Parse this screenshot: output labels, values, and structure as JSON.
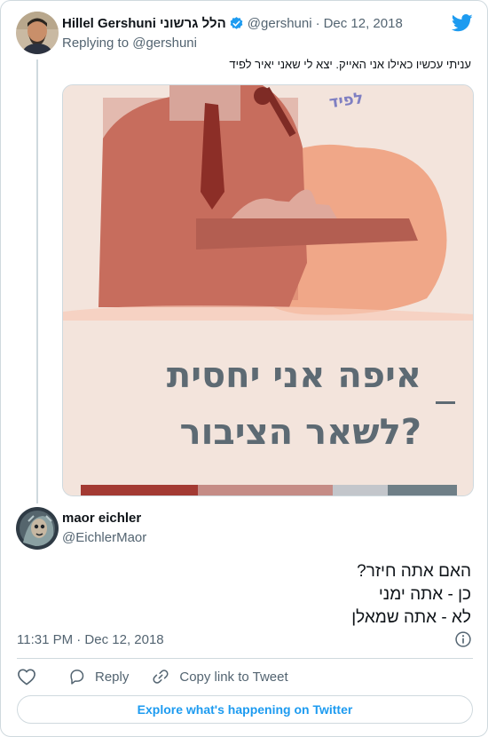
{
  "parent_tweet": {
    "display_name": "Hillel Gershuni הלל גרשוני",
    "handle": "@gershuni",
    "separator": "·",
    "date": "Dec 12, 2018",
    "replying_prefix": "Replying to",
    "replying_to": "@gershuni",
    "text": "עניתי עכשיו כאילו אני האייק. יצא לי שאני יאיר לפיד",
    "verified": true,
    "avatar_icon": "user-avatar-photo",
    "media": {
      "image_icon": "poster-photo",
      "corner_text": "לפיד",
      "headline_line1": "איפה אני יחסית",
      "headline_line2": "לשאר הציבור?",
      "colors": {
        "background": "#f3e4dc",
        "photo_tint": "#c76d5d",
        "blob": "#f0a788",
        "headline": "#5d6a73"
      },
      "strip_colors": [
        "#a33a33",
        "#c58c86",
        "#c3c6cb",
        "#6f7f87"
      ]
    }
  },
  "main_tweet": {
    "display_name": "maor eichler",
    "handle": "@EichlerMaor",
    "text_lines": [
      "האם אתה חיזר?",
      "כן - אתה ימני",
      "לא - אתה שמאלן"
    ],
    "timestamp": "11:31 PM · Dec 12, 2018",
    "avatar_icon": "user-avatar-photo"
  },
  "actions": {
    "like_icon": "heart-icon",
    "reply_icon": "reply-icon",
    "reply_label": "Reply",
    "copy_icon": "link-icon",
    "copy_label": "Copy link to Tweet",
    "info_icon": "info-icon"
  },
  "footer": {
    "explore_label": "Explore what's happening on Twitter"
  },
  "colors": {
    "text_primary": "#0f1419",
    "text_secondary": "#536471",
    "accent": "#1d9bf0",
    "border": "#cfd9de"
  }
}
